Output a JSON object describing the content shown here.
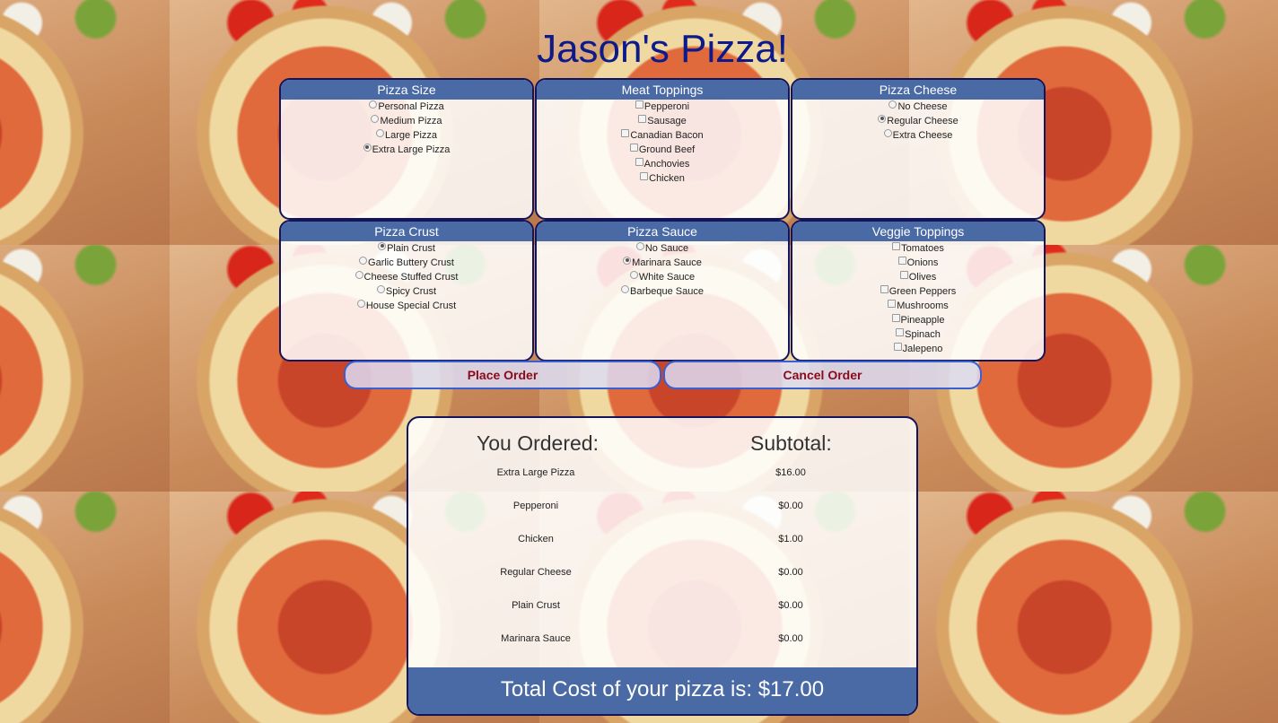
{
  "title": "Jason's Pizza!",
  "panels": {
    "size": {
      "header": "Pizza Size",
      "options": [
        "Personal Pizza",
        "Medium Pizza",
        "Large Pizza",
        "Extra Large Pizza"
      ],
      "selected": "Extra Large Pizza"
    },
    "meat": {
      "header": "Meat Toppings",
      "options": [
        "Pepperoni",
        "Sausage",
        "Canadian Bacon",
        "Ground Beef",
        "Anchovies",
        "Chicken"
      ]
    },
    "cheese": {
      "header": "Pizza Cheese",
      "options": [
        "No Cheese",
        "Regular Cheese",
        "Extra Cheese"
      ],
      "selected": "Regular Cheese"
    },
    "crust": {
      "header": "Pizza Crust",
      "options": [
        "Plain Crust",
        "Garlic Buttery Crust",
        "Cheese Stuffed Crust",
        "Spicy Crust",
        "House Special Crust"
      ],
      "selected": "Plain Crust"
    },
    "sauce": {
      "header": "Pizza Sauce",
      "options": [
        "No Sauce",
        "Marinara Sauce",
        "White Sauce",
        "Barbeque Sauce"
      ],
      "selected": "Marinara Sauce"
    },
    "veggie": {
      "header": "Veggie Toppings",
      "options": [
        "Tomatoes",
        "Onions",
        "Olives",
        "Green Peppers",
        "Mushrooms",
        "Pineapple",
        "Spinach",
        "Jalepeno"
      ]
    }
  },
  "buttons": {
    "place": "Place Order",
    "cancel": "Cancel Order"
  },
  "summary": {
    "ordered_header": "You Ordered:",
    "subtotal_header": "Subtotal:",
    "items": [
      {
        "name": "Extra Large Pizza",
        "price": "$16.00"
      },
      {
        "name": "Pepperoni",
        "price": "$0.00"
      },
      {
        "name": "Chicken",
        "price": "$1.00"
      },
      {
        "name": "Regular Cheese",
        "price": "$0.00"
      },
      {
        "name": "Plain Crust",
        "price": "$0.00"
      },
      {
        "name": "Marinara Sauce",
        "price": "$0.00"
      }
    ],
    "total": "Total Cost of your pizza is: $17.00"
  },
  "colors": {
    "title": "#0c1a8a",
    "header_bar": "#4a6aa6",
    "button_text": "#8b0a1a",
    "button_border": "#3a5fd0"
  }
}
